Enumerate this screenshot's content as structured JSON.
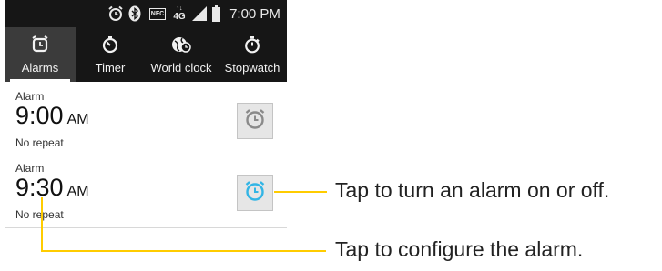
{
  "status_bar": {
    "icons": [
      "alarm-icon",
      "bluetooth-icon",
      "nfc-icon",
      "data-4g-icon",
      "signal-icon",
      "battery-icon"
    ],
    "nfc_label": "NFC",
    "network_label": "4G",
    "time": "7:00 PM"
  },
  "tabs": [
    {
      "label": "Alarms",
      "icon": "alarm-clock-icon",
      "selected": true
    },
    {
      "label": "Timer",
      "icon": "timer-icon",
      "selected": false
    },
    {
      "label": "World clock",
      "icon": "world-clock-icon",
      "selected": false
    },
    {
      "label": "Stopwatch",
      "icon": "stopwatch-icon",
      "selected": false
    }
  ],
  "alarms": [
    {
      "label": "Alarm",
      "time": "9:00",
      "ampm": "AM",
      "repeat": "No repeat",
      "enabled": false,
      "toggle_icon": "alarm-off-icon"
    },
    {
      "label": "Alarm",
      "time": "9:30",
      "ampm": "AM",
      "repeat": "No repeat",
      "enabled": true,
      "toggle_icon": "alarm-on-icon"
    }
  ],
  "callouts": {
    "toggle": "Tap to turn an alarm on or off.",
    "configure": "Tap to configure the alarm."
  },
  "colors": {
    "bar_bg": "#161616",
    "selected_tab": "#3b3b3b",
    "alarm_on": "#33b5e5",
    "alarm_off": "#8a8a8a",
    "callout_line": "#ffcc00"
  }
}
